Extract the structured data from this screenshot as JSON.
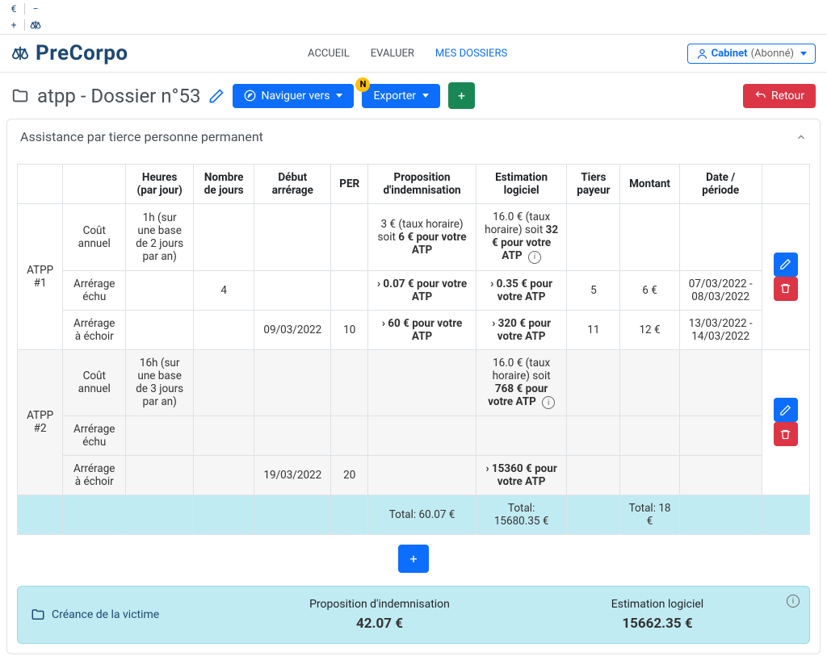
{
  "util": {
    "euro": "€",
    "minus": "−",
    "plus": "+"
  },
  "logo": "PreCorpo",
  "nav": {
    "accueil": "ACCUEIL",
    "evaluer": "EVALUER",
    "mesdossiers": "MES DOSSIERS"
  },
  "cabinet": {
    "label": "Cabinet",
    "sub": "(Abonné)"
  },
  "title": "atpp - Dossier n°53",
  "buttons": {
    "naviguer": "Naviguer vers",
    "exporter": "Exporter",
    "retour": "Retour",
    "badge_n": "N"
  },
  "panel_title": "Assistance par tierce personne permanent",
  "headers": [
    "",
    "",
    "Heures (par jour)",
    "Nombre de jours",
    "Début arrérage",
    "PER",
    "Proposition d'indemnisation",
    "Estimation logiciel",
    "Tiers payeur",
    "Montant",
    "Date / période"
  ],
  "subrows": {
    "cout_annuel": "Coût annuel",
    "arr_echu": "Arrérage échu",
    "arr_echoir": "Arrérage à échoir"
  },
  "atpp1": {
    "label": "ATPP #1",
    "heures": "1h (sur une base de 2 jours par an)",
    "cout_prop_pre": "3 € (taux horaire) soit ",
    "cout_prop_bold": "6 € pour votre ATP",
    "cout_est_pre": "16.0 € (taux horaire) soit ",
    "cout_est_bold": "32 € pour votre ATP",
    "echu_jours": "4",
    "echu_prop": "› 0.07 € pour votre ATP",
    "echu_est": "› 0.35 € pour votre ATP",
    "echu_tiers": "5",
    "echu_montant": "6 €",
    "echu_date": "07/03/2022 - 08/03/2022",
    "echoir_debut": "09/03/2022",
    "echoir_per": "10",
    "echoir_prop": "› 60 € pour votre ATP",
    "echoir_est": "› 320 € pour votre ATP",
    "echoir_tiers": "11",
    "echoir_montant": "12 €",
    "echoir_date": "13/03/2022 - 14/03/2022"
  },
  "atpp2": {
    "label": "ATPP #2",
    "heures": "16h (sur une base de 3 jours par an)",
    "cout_est_pre": "16.0 € (taux horaire) soit ",
    "cout_est_bold": "768 € pour votre ATP",
    "echoir_debut": "19/03/2022",
    "echoir_per": "20",
    "echoir_est": "› 15360 € pour votre ATP"
  },
  "totals": {
    "prop": "Total: 60.07 €",
    "est": "Total: 15680.35 €",
    "montant": "Total: 18 €"
  },
  "summary": {
    "left": "Créance de la victime",
    "prop_label": "Proposition d'indemnisation",
    "prop_value": "42.07 €",
    "est_label": "Estimation logiciel",
    "est_value": "15662.35 €"
  }
}
